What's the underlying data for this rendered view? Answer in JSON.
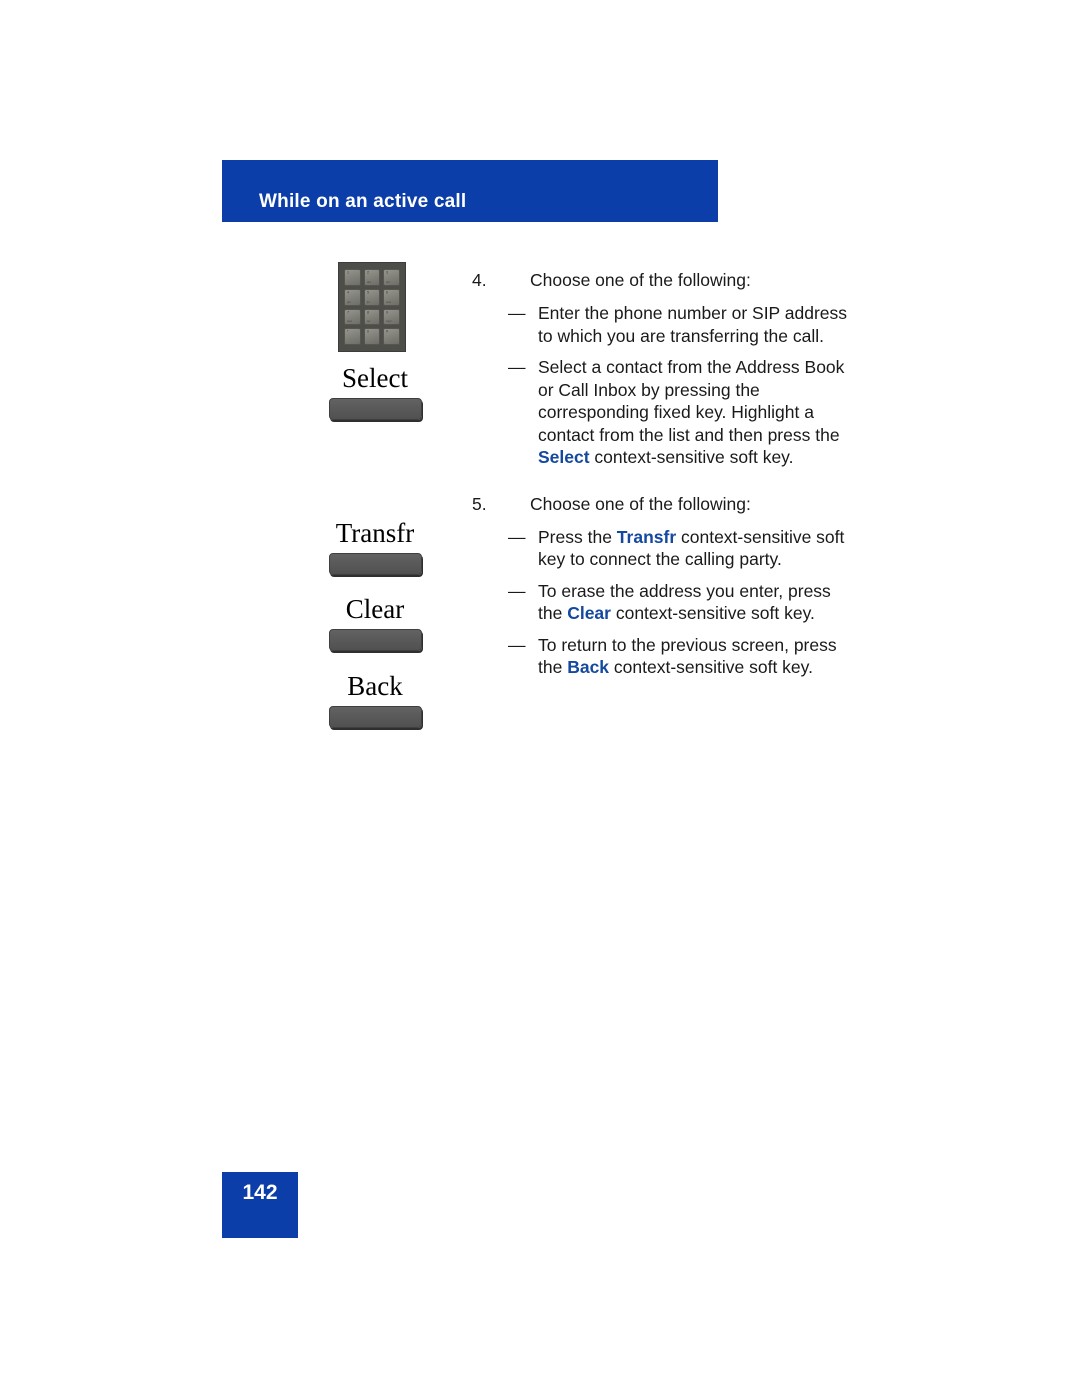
{
  "document": {
    "section_header": "While on an active call",
    "page_number": "142",
    "header_color": "#0B3EA8",
    "keyword_color": "#15489F"
  },
  "illustrations": {
    "keypad": {
      "name": "dialpad-keypad",
      "keys": [
        {
          "glyph": "1",
          "sub": ""
        },
        {
          "glyph": "2",
          "sub": "abc"
        },
        {
          "glyph": "3",
          "sub": "def"
        },
        {
          "glyph": "4",
          "sub": "ghi"
        },
        {
          "glyph": "5",
          "sub": "jkl"
        },
        {
          "glyph": "6",
          "sub": "mno"
        },
        {
          "glyph": "7",
          "sub": "pqrs"
        },
        {
          "glyph": "8",
          "sub": "tuv"
        },
        {
          "glyph": "9",
          "sub": "wxyz"
        },
        {
          "glyph": "*",
          "sub": ""
        },
        {
          "glyph": "0",
          "sub": ""
        },
        {
          "glyph": "#",
          "sub": ""
        }
      ]
    },
    "softkeys": [
      {
        "label": "Select"
      },
      {
        "label": "Transfr"
      },
      {
        "label": "Clear"
      },
      {
        "label": "Back"
      }
    ]
  },
  "steps": [
    {
      "number": "4.",
      "text": "Choose one of the following:",
      "bullets": [
        {
          "dash": "—",
          "lines": [
            {
              "segments": [
                {
                  "t": "Enter the phone number or SIP address to which you are transferring the call.",
                  "kw": false
                }
              ]
            }
          ]
        },
        {
          "dash": "—",
          "lines": [
            {
              "segments": [
                {
                  "t": "Select a contact from the Address Book or Call Inbox by pressing the corresponding fixed key. Highlight a contact from the list and then press the ",
                  "kw": false
                },
                {
                  "t": "Select",
                  "kw": true
                },
                {
                  "t": " context-sensitive soft key.",
                  "kw": false
                }
              ]
            }
          ]
        }
      ]
    },
    {
      "number": "5.",
      "text": "Choose one of the following:",
      "bullets": [
        {
          "dash": "—",
          "lines": [
            {
              "segments": [
                {
                  "t": "Press the ",
                  "kw": false
                },
                {
                  "t": "Transfr",
                  "kw": true
                },
                {
                  "t": " context-sensitive soft key to connect the calling party.",
                  "kw": false
                }
              ]
            }
          ]
        },
        {
          "dash": "—",
          "lines": [
            {
              "segments": [
                {
                  "t": "To erase the address you enter, press the ",
                  "kw": false
                },
                {
                  "t": "Clear",
                  "kw": true
                },
                {
                  "t": " context-sensitive soft key.",
                  "kw": false
                }
              ]
            }
          ]
        },
        {
          "dash": "—",
          "lines": [
            {
              "segments": [
                {
                  "t": "To return to the previous screen, press the ",
                  "kw": false
                },
                {
                  "t": "Back",
                  "kw": true
                },
                {
                  "t": " context-sensitive soft key.",
                  "kw": false
                }
              ]
            }
          ]
        }
      ]
    }
  ]
}
